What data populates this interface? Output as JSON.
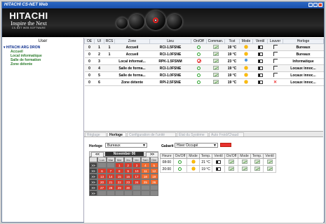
{
  "window": {
    "title": "HITACHI CS-NET Web"
  },
  "brand": {
    "name": "HITACHI",
    "tagline": "Inspire the Next",
    "sub": "CS-NET WEB SOFTWARE"
  },
  "sidebar": {
    "header": "User",
    "root": "HITACHI ARG DRON",
    "items": [
      "Accueil",
      "Local informatique",
      "Salle de formation",
      "Zone détente"
    ]
  },
  "grid": {
    "columns": [
      "OE",
      "UI",
      "RCS",
      "Zone",
      "Lieu",
      "On/Off",
      "Comman.",
      "Tcst",
      "Mode",
      "Ventil",
      "Louver",
      "Horloge"
    ],
    "rows": [
      {
        "oe": "0",
        "ui": "1",
        "rcs": "1",
        "zone": "Accueil",
        "lieu": "RCI-1.5FSNE",
        "onoff": "on",
        "tcst": "19 °C",
        "mode": "heat",
        "horloge": "Bureaux",
        "selected": true
      },
      {
        "oe": "0",
        "ui": "2",
        "rcs": "1",
        "zone": "Accueil",
        "lieu": "RCI-1.0FSNE",
        "onoff": "on",
        "tcst": "19 °C",
        "mode": "heat",
        "horloge": "Bureaux",
        "selected": false
      },
      {
        "oe": "0",
        "ui": "3",
        "rcs": "",
        "zone": "Local informat...",
        "lieu": "RPK-1.5FSNM",
        "onoff": "alarm",
        "tcst": "23 °C",
        "mode": "cool",
        "horloge": "Informatique",
        "selected": false
      },
      {
        "oe": "0",
        "ui": "4",
        "rcs": "",
        "zone": "Salle de forma...",
        "lieu": "RCI-1.0FSNE",
        "onoff": "on",
        "tcst": "19 °C",
        "mode": "heat",
        "horloge": "Locaux innoc...",
        "selected": true
      },
      {
        "oe": "0",
        "ui": "5",
        "rcs": "",
        "zone": "Salle de forma...",
        "lieu": "RCI-1.0FSNE",
        "onoff": "on",
        "tcst": "19 °C",
        "mode": "heat",
        "horloge": "Locaux innoc...",
        "selected": false
      },
      {
        "oe": "0",
        "ui": "6",
        "rcs": "",
        "zone": "Zone détente",
        "lieu": "RPI-2.5FSNE",
        "onoff": "on",
        "tcst": "19 °C",
        "mode": "heat",
        "horloge": "Locaux innoc...",
        "selected": false,
        "louver_x": true
      }
    ]
  },
  "tabs": [
    "Réglage",
    "Horloge",
    "Configuration de l'unité",
    "État du Système",
    "Auto Froid/Chaud"
  ],
  "active_tab": "Horloge",
  "horloge": {
    "label": "Horloge",
    "value": "Bureaux",
    "gabarit_label": "Gabarit",
    "gabarit_value": "Hiver Occupé",
    "calendar": {
      "prev": "<<",
      "next": ">>",
      "month": "November 06",
      "weekday_headers": [
        "",
        "Lun",
        "Mar",
        "Mer",
        "Jeu",
        "Ven",
        "Sam",
        "Dim"
      ],
      "weeks": [
        [
          ">>",
          "",
          "",
          "1",
          "2",
          "3",
          "4",
          "5"
        ],
        [
          ">>",
          "6",
          "7",
          "8",
          "9",
          "10",
          "11",
          "12"
        ],
        [
          ">>",
          "13",
          "14",
          "15",
          "16",
          "17",
          "18",
          "19"
        ],
        [
          ">>",
          "20",
          "21",
          "22",
          "23",
          "24",
          "25",
          "26"
        ],
        [
          ">>",
          "27",
          "28",
          "29",
          "30",
          "",
          "",
          ""
        ],
        [
          ">>",
          "",
          "",
          "",
          "",
          "",
          "",
          ""
        ]
      ]
    },
    "schedule": {
      "headers": [
        "Heure",
        "On/Off",
        "Mode",
        "Temp.",
        "Ventil",
        "On/Off",
        "Mode",
        "Temp.",
        "Ventil"
      ],
      "rows": [
        {
          "heure": "08:00",
          "temp": "21 °C"
        },
        {
          "heure": "20:00",
          "temp": "19 °C"
        }
      ]
    }
  }
}
